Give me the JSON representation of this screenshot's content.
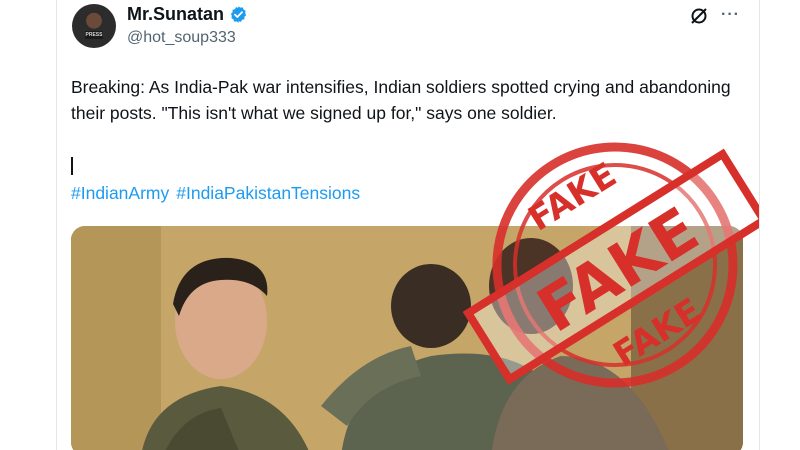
{
  "tweet": {
    "display_name": "Mr.Sunatan",
    "handle": "@hot_soup333",
    "avatar_badge": "PRESS",
    "text": "Breaking: As India-Pak war intensifies, Indian soldiers spotted crying and abandoning their posts. \"This isn't what we signed up for,\" says one soldier.",
    "hashtags": [
      "#IndianArmy",
      "#IndiaPakistanTensions"
    ],
    "more_label": "···"
  },
  "stamp": {
    "top_word": "FAKE",
    "center_word": "FAKE",
    "bottom_word": "FAKE",
    "color": "#d72f2a"
  },
  "colors": {
    "link": "#1d9bf0",
    "verified": "#1d9bf0",
    "secondary_text": "#536471"
  },
  "icons": {
    "verified": "verified-badge-icon",
    "grok": "grok-icon",
    "more": "more-options-icon"
  }
}
